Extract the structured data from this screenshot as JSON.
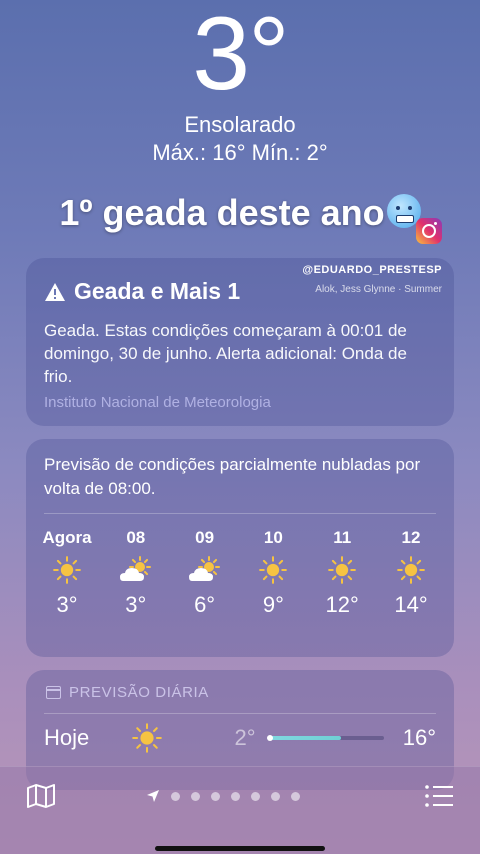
{
  "current": {
    "temperature": "3°",
    "condition": "Ensolarado",
    "hilo": "Máx.: 16°  Mín.: 2°"
  },
  "overlay": {
    "title": "1º geada deste ano",
    "watermark": "@EDUARDO_PRESTESP",
    "music": "Alok, Jess Glynne · Summer"
  },
  "alert": {
    "title": "Geada e Mais 1",
    "body": "Geada. Estas condições começaram à 00:01 de domingo, 30 de junho. Alerta adicional: Onda de frio.",
    "source": "Instituto Nacional de Meteorologia"
  },
  "hourly": {
    "description": "Previsão de condições parcialmente nubladas por volta de 08:00.",
    "items": [
      {
        "label": "Agora",
        "icon": "sun-icon",
        "temp": "3°"
      },
      {
        "label": "08",
        "icon": "partly-cloudy-icon",
        "temp": "3°"
      },
      {
        "label": "09",
        "icon": "partly-cloudy-icon",
        "temp": "6°"
      },
      {
        "label": "10",
        "icon": "sun-icon",
        "temp": "9°"
      },
      {
        "label": "11",
        "icon": "sun-icon",
        "temp": "12°"
      },
      {
        "label": "12",
        "icon": "sun-icon",
        "temp": "14°"
      }
    ]
  },
  "daily": {
    "header": "PREVISÃO DIÁRIA",
    "rows": [
      {
        "day": "Hoje",
        "icon": "sun-icon",
        "low": "2°",
        "high": "16°",
        "range_fill": 0.62
      }
    ]
  },
  "pager": {
    "pages": 7,
    "current": 0
  },
  "colors": {
    "sun": "#f6c342",
    "range": "#74d3da"
  }
}
